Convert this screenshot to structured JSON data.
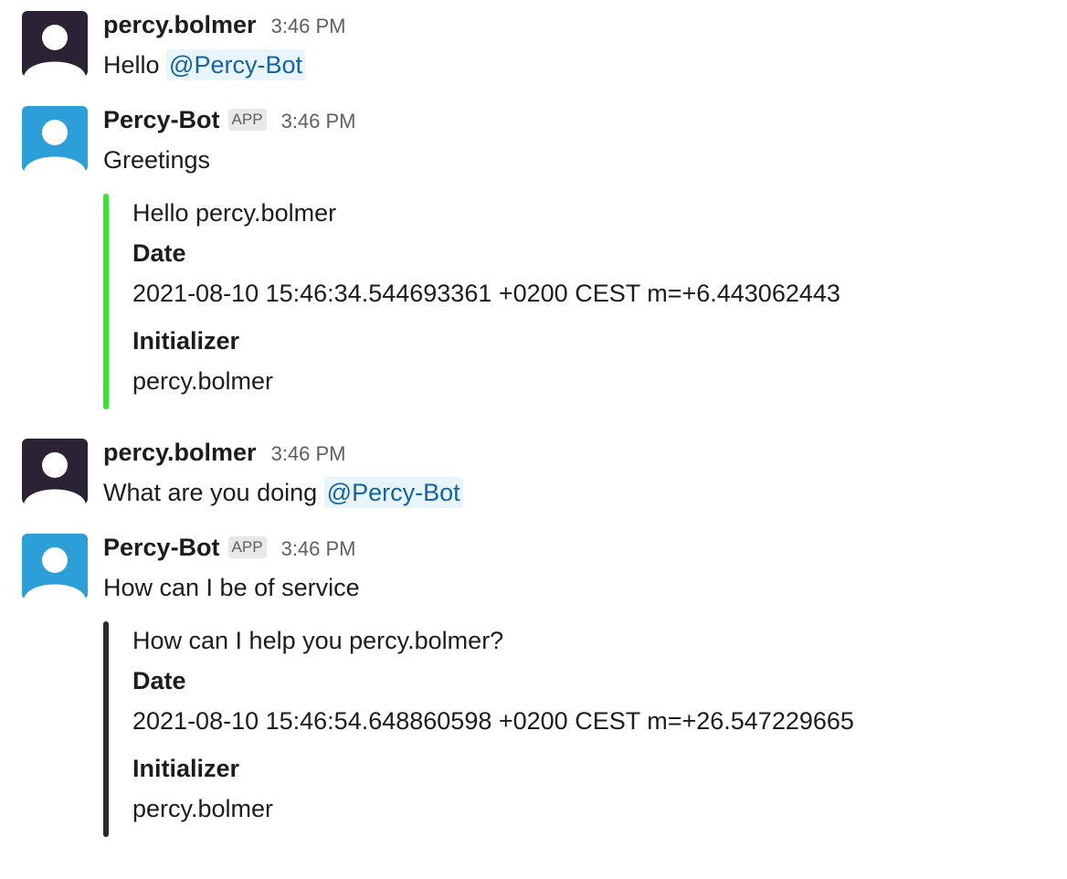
{
  "messages": [
    {
      "author": "percy.bolmer",
      "time": "3:46 PM",
      "text": "Hello ",
      "mention": "@Percy-Bot"
    },
    {
      "author": "Percy-Bot",
      "badge": "APP",
      "time": "3:46 PM",
      "text": "Greetings",
      "attachment": {
        "color": "#2ee82a",
        "title": "Hello percy.bolmer",
        "fields": [
          {
            "label": "Date",
            "value": "2021-08-10 15:46:34.544693361 +0200 CEST m=+6.443062443"
          },
          {
            "label": "Initializer",
            "value": "percy.bolmer"
          }
        ]
      }
    },
    {
      "author": "percy.bolmer",
      "time": "3:46 PM",
      "text": "What are you doing ",
      "mention": "@Percy-Bot"
    },
    {
      "author": "Percy-Bot",
      "badge": "APP",
      "time": "3:46 PM",
      "text": "How can I be of service",
      "attachment": {
        "color": "#2b2a33",
        "title": "How can I help you percy.bolmer?",
        "fields": [
          {
            "label": "Date",
            "value": "2021-08-10 15:46:54.648860598 +0200 CEST m=+26.547229665"
          },
          {
            "label": "Initializer",
            "value": "percy.bolmer"
          }
        ]
      }
    }
  ],
  "colors": {
    "user_avatar_bg": "#2b2233",
    "bot_avatar_bg": "#2d9fd8",
    "mention_bg": "#e8f5fa",
    "mention_text": "#1264a3"
  },
  "icons": {
    "user_avatar": "default-user-avatar-icon",
    "bot_avatar": "default-bot-avatar-icon"
  }
}
